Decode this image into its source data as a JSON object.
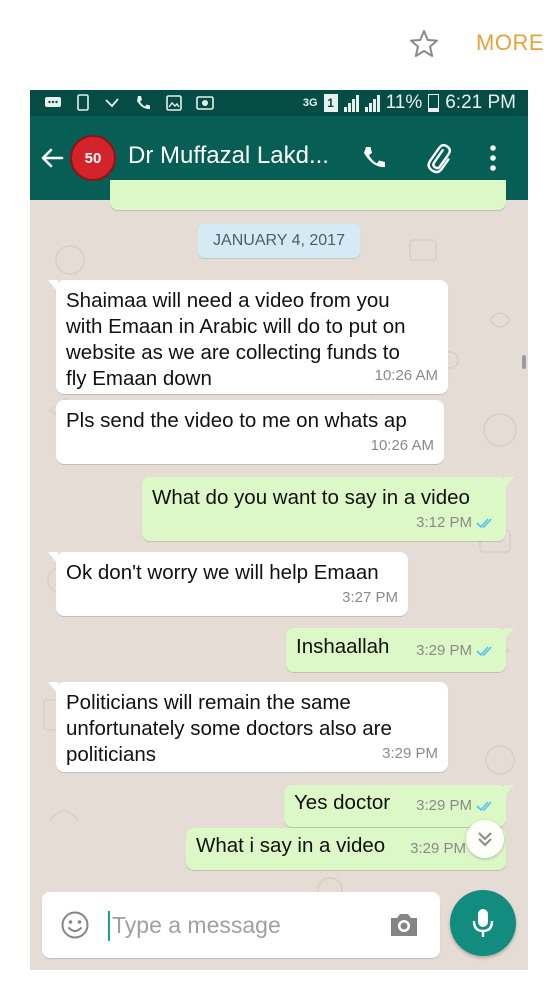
{
  "viewer": {
    "more_label": "MORE",
    "star_icon": "star-outline-icon"
  },
  "colors": {
    "header": "#075e54",
    "status_bar": "#054d44",
    "outgoing": "#dcf8c6",
    "incoming": "#ffffff",
    "accent": "#128c7e",
    "more": "#e6a23c",
    "read_ticks": "#4fc3f7"
  },
  "status_bar": {
    "network": "3G",
    "sim": "1",
    "battery": "11%",
    "time": "6:21 PM"
  },
  "header": {
    "avatar_text": "50",
    "contact_name": "Dr Muffazal Lakd..."
  },
  "chat": {
    "date_label": "JANUARY 4, 2017",
    "messages": [
      {
        "direction": "in",
        "text": "Shaimaa will need a video from you with Emaan in Arabic will do to put on website as we are collecting funds to fly Emaan down",
        "time": "10:26 AM"
      },
      {
        "direction": "in",
        "text": "Pls send the video to me on whats ap",
        "time": "10:26 AM"
      },
      {
        "direction": "out",
        "text": "What do you want to say in a video",
        "time": "3:12 PM",
        "status": "read"
      },
      {
        "direction": "in",
        "text": "Ok don't worry we will help Emaan",
        "time": "3:27 PM"
      },
      {
        "direction": "out",
        "text": "Inshaallah",
        "time": "3:29 PM",
        "status": "read"
      },
      {
        "direction": "in",
        "text": "Politicians will remain the same unfortunately some doctors also are politicians",
        "time": "3:29 PM"
      },
      {
        "direction": "out",
        "text": "Yes doctor",
        "time": "3:29 PM",
        "status": "read"
      },
      {
        "direction": "out",
        "text": "What i say in a video",
        "time": "3:29 PM"
      }
    ]
  },
  "composer": {
    "placeholder": "Type a message"
  }
}
